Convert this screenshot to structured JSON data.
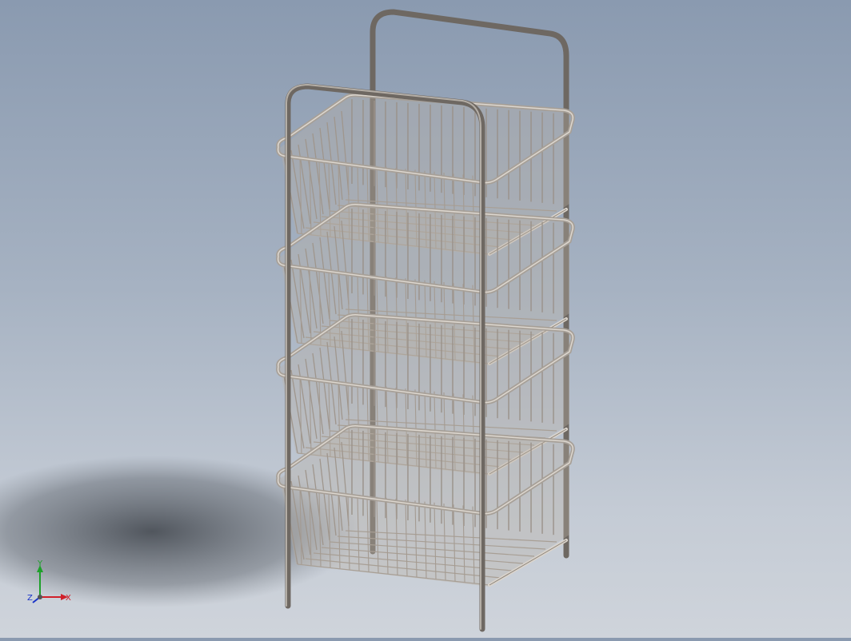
{
  "scene": {
    "model": "four-tier-wire-basket-rack",
    "basket_count": 4,
    "colors": {
      "background_top": "#8a9ab0",
      "background_bottom": "#cfd4db",
      "frame": "#7a746d",
      "basket": "#cdc6bc",
      "shadow": "#4a4f57"
    }
  },
  "triad": {
    "x_label": "X",
    "y_label": "Y",
    "z_label": "Z",
    "x_color": "#d0202a",
    "y_color": "#1ea02a",
    "z_color": "#1a34c8"
  }
}
